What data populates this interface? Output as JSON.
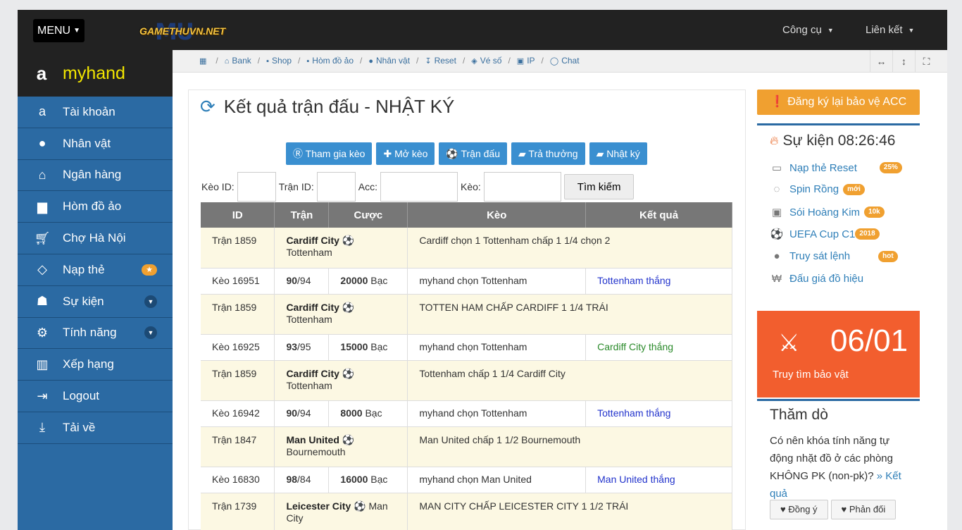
{
  "topbar": {
    "menu_label": "MENU",
    "logo_text": "GAMETHUVN.NET",
    "logo_mark": "MU",
    "tools_label": "Công cụ",
    "links_label": "Liên kết"
  },
  "sidebar": {
    "username": "myhand",
    "items": [
      {
        "label": "Tài khoản",
        "icon": "amazon-icon"
      },
      {
        "label": "Nhân vật",
        "icon": "user-icon"
      },
      {
        "label": "Ngân hàng",
        "icon": "bank-icon"
      },
      {
        "label": "Hòm đồ ảo",
        "icon": "briefcase-icon"
      },
      {
        "label": "Chợ Hà Nội",
        "icon": "cart-icon"
      },
      {
        "label": "Nạp thẻ",
        "icon": "diamond-icon"
      },
      {
        "label": "Sự kiện",
        "icon": "android-icon"
      },
      {
        "label": "Tính năng",
        "icon": "gears-icon"
      },
      {
        "label": "Xếp hạng",
        "icon": "bar-chart-icon"
      },
      {
        "label": "Logout",
        "icon": "sign-out-icon"
      },
      {
        "label": "Tải về",
        "icon": "download-icon"
      }
    ]
  },
  "breadcrumb": [
    "Bank",
    "Shop",
    "Hòm đồ ảo",
    "Nhân vật",
    "Reset",
    "Vé số",
    "IP",
    "Chat"
  ],
  "main": {
    "title": "Kết quả trận đấu - NHẬT KÝ",
    "tabs": [
      "Tham gia kèo",
      "Mở kèo",
      "Trận đấu",
      "Trả thưởng",
      "Nhật ký"
    ],
    "filters": {
      "keo_id": "Kèo ID:",
      "tran_id": "Trận ID:",
      "acc": "Acc:",
      "keo": "Kèo:",
      "search": "Tìm kiếm"
    },
    "columns": [
      "ID",
      "Trận",
      "Cược",
      "Kèo",
      "Kết quả"
    ],
    "rows": [
      {
        "type": "match",
        "id": "Trận 1859",
        "home": "Cardiff City",
        "away": "Tottenham",
        "keo": "Cardiff chọn 1 Tottenham chấp 1 1/4 chọn 2"
      },
      {
        "type": "bet",
        "id": "Kèo 16951",
        "odds_a": "90",
        "odds_b": "/94",
        "amount": "20000",
        "unit": "Bạc",
        "keo": "myhand chọn Tottenham",
        "result": "Tottenham thắng",
        "result_color": "blue"
      },
      {
        "type": "match",
        "id": "Trận 1859",
        "home": "Cardiff City",
        "away": "Tottenham",
        "keo": "TOTTEN HAM CHẤP CARDIFF 1 1/4 TRÁI"
      },
      {
        "type": "bet",
        "id": "Kèo 16925",
        "odds_a": "93",
        "odds_b": "/95",
        "amount": "15000",
        "unit": "Bạc",
        "keo": "myhand chọn Tottenham",
        "result": "Cardiff City thắng",
        "result_color": "green"
      },
      {
        "type": "match",
        "id": "Trận 1859",
        "home": "Cardiff City",
        "away": "Tottenham",
        "keo": "Tottenham chấp 1 1/4 Cardiff City"
      },
      {
        "type": "bet",
        "id": "Kèo 16942",
        "odds_a": "90",
        "odds_b": "/94",
        "amount": "8000",
        "unit": "Bạc",
        "keo": "myhand chọn Tottenham",
        "result": "Tottenham thắng",
        "result_color": "blue"
      },
      {
        "type": "match",
        "id": "Trận 1847",
        "home": "Man United",
        "away": "Bournemouth",
        "keo": "Man United chấp 1 1/2 Bournemouth"
      },
      {
        "type": "bet",
        "id": "Kèo 16830",
        "odds_a": "98",
        "odds_b": "/84",
        "amount": "16000",
        "unit": "Bạc",
        "keo": "myhand chọn Man United",
        "result": "Man United thắng",
        "result_color": "blue"
      },
      {
        "type": "match",
        "id": "Trận 1739",
        "home": "Leicester City",
        "away": "Man City",
        "keo": "MAN CITY CHẤP LEICESTER CITY 1 1/2 TRÁI"
      }
    ]
  },
  "right": {
    "register_label": "Đăng ký lại bảo vệ ACC",
    "events_title": "Sự kiện 08:26:46",
    "events": [
      {
        "label": "Nạp thẻ Reset",
        "badge": "25%",
        "icon": "money-icon"
      },
      {
        "label": "Spin Rồng",
        "badge": "mới",
        "icon": "spinner-icon"
      },
      {
        "label": "Sói Hoàng Kim",
        "badge": "10k",
        "icon": "gift-icon"
      },
      {
        "label": "UEFA Cup C1",
        "badge": "2018",
        "icon": "soccer-ball-icon"
      },
      {
        "label": "Truy sát lệnh",
        "badge": "hot",
        "icon": "github-icon"
      },
      {
        "label": "Đấu giá đồ hiệu",
        "badge": "",
        "icon": "won-icon"
      }
    ],
    "treasure_date": "06/01",
    "treasure_label": "Truy tìm bảo vật",
    "poll_title": "Thăm dò",
    "poll_question": "Có nên khóa tính năng tự động nhặt đồ ở các phòng KHÔNG PK (non-pk)?",
    "poll_link": "» Kết quả",
    "poll_yes": "Đồng ý",
    "poll_no": "Phản đối"
  },
  "colors": {
    "sidebar": "#2b6aa3",
    "topbar": "#222222",
    "orange": "#f0a030",
    "treasure": "#f25e2e",
    "tab": "#3a8fd0"
  }
}
